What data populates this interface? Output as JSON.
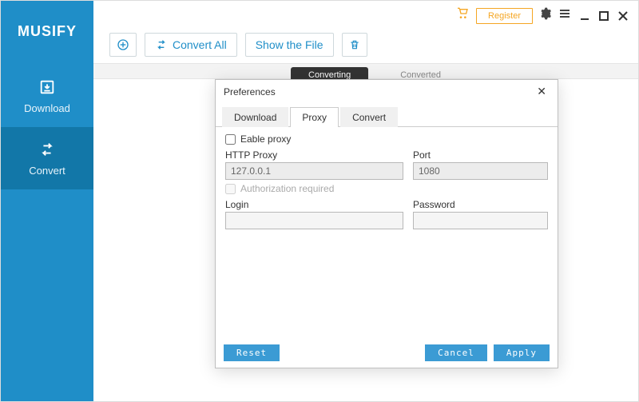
{
  "app": {
    "name": "MUSIFY"
  },
  "topbar": {
    "register": "Register"
  },
  "sidebar": {
    "items": [
      {
        "label": "Download"
      },
      {
        "label": "Convert"
      }
    ]
  },
  "toolbar": {
    "convert_all": "Convert All",
    "show_file": "Show the File"
  },
  "bg_tabs": {
    "converting": "Converting",
    "converted": "Converted"
  },
  "modal": {
    "title": "Preferences",
    "tabs": {
      "download": "Download",
      "proxy": "Proxy",
      "convert": "Convert"
    },
    "enable_proxy": "Eable proxy",
    "http_proxy_label": "HTTP Proxy",
    "http_proxy_value": "127.0.0.1",
    "port_label": "Port",
    "port_value": "1080",
    "auth_required": "Authorization required",
    "login_label": "Login",
    "login_value": "",
    "password_label": "Password",
    "password_value": "",
    "reset": "Reset",
    "cancel": "Cancel",
    "apply": "Apply"
  }
}
